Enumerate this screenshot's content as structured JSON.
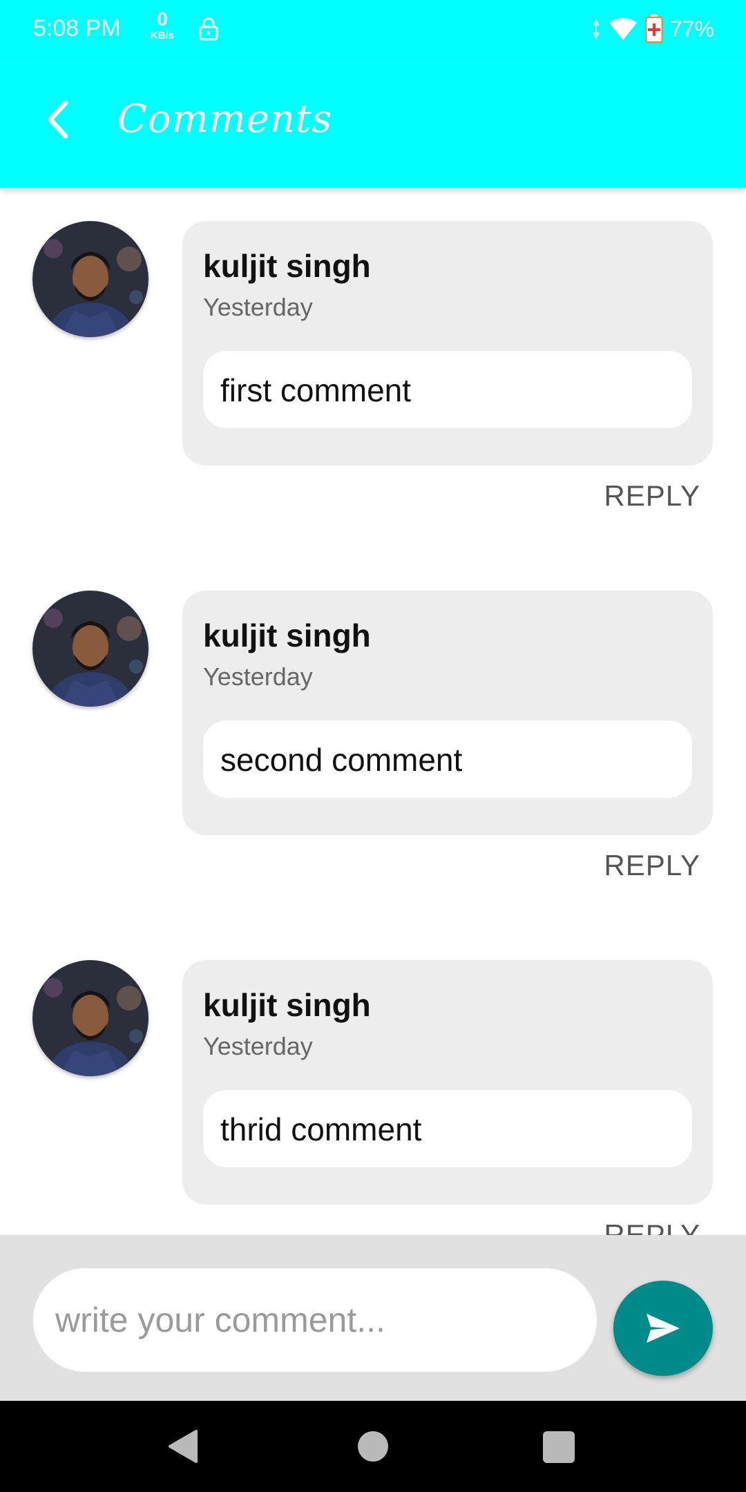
{
  "status_bar": {
    "time": "5:08 PM",
    "net_speed_value": "0",
    "net_speed_unit": "KB/s",
    "battery_percent": "77%",
    "icons": [
      "lock-icon",
      "signal-icon",
      "wifi-icon",
      "battery-icon"
    ]
  },
  "app_bar": {
    "title": "Comments",
    "back_icon": "chevron-left-icon"
  },
  "comments": [
    {
      "author": "kuljit singh",
      "time": "Yesterday",
      "text": "first comment",
      "reply_label": "REPLY"
    },
    {
      "author": "kuljit singh",
      "time": "Yesterday",
      "text": "second comment",
      "reply_label": "REPLY"
    },
    {
      "author": "kuljit singh",
      "time": "Yesterday",
      "text": "thrid comment",
      "reply_label": "REPLY"
    }
  ],
  "composer": {
    "placeholder": "write your comment...",
    "value": "",
    "send_icon": "send-icon"
  },
  "colors": {
    "app_bar": "#00ffff",
    "send_button": "#008b8b",
    "bubble": "#eeedee",
    "composer_bar": "#e1e1e1"
  }
}
